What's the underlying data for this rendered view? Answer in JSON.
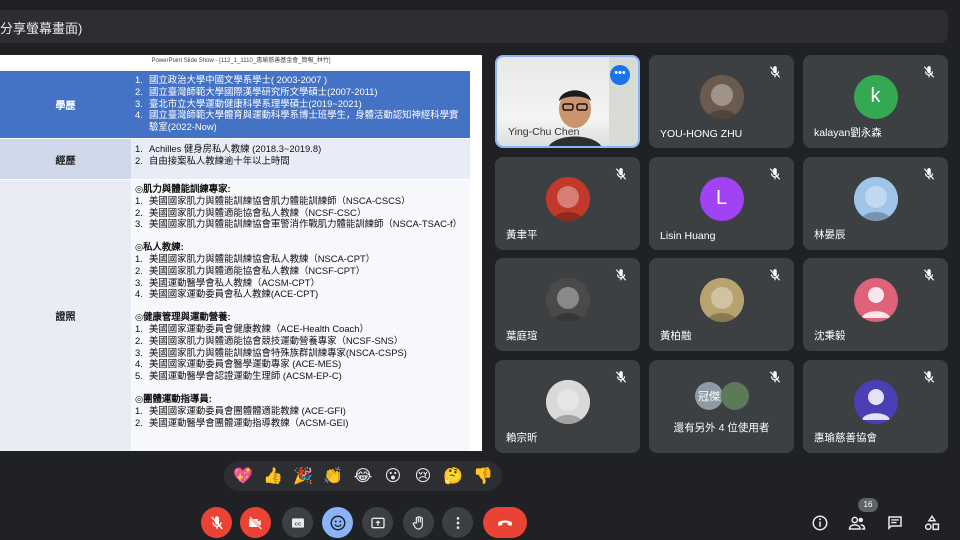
{
  "topbar": {
    "title": "分享螢幕畫面)"
  },
  "slide": {
    "header": "PowerPoint Slide Show - [112_1_1110_惠瑜慈善基金會_簡報_林竹]",
    "rows": [
      {
        "label": "學歷",
        "items": [
          {
            "n": "1.",
            "t": "國立政治大學中國文學系學士( 2003-2007 )"
          },
          {
            "n": "2.",
            "t": "國立臺灣師範大學國際漢學研究所文學碩士(2007-2011)"
          },
          {
            "n": "3.",
            "t": "臺北市立大學運動健康科學系理學碩士(2019~2021)"
          },
          {
            "n": "4.",
            "t": "國立臺灣師範大學體育與運動科學系博士班學生，身體活動認知神經科學實"
          },
          {
            "n": "",
            "t": "驗室(2022-Now)"
          }
        ]
      },
      {
        "label": "經歷",
        "items": [
          {
            "n": "1.",
            "t": "Achilles 健身房私人教練 (2018.3~2019.8)"
          },
          {
            "n": "2.",
            "t": "自由接案私人教練逾十年以上時間"
          }
        ]
      },
      {
        "label": "證照",
        "sections": [
          {
            "title": "◎肌力與體能訓練專家:",
            "items": [
              {
                "n": "1.",
                "t": "美國國家肌力與體能訓練協會肌力體能訓練師（NSCA-CSCS）"
              },
              {
                "n": "2.",
                "t": "美國國家肌力與體適能協會私人教練（NCSF-CSC）"
              },
              {
                "n": "3.",
                "t": "美國國家肌力與體能訓練協會軍警消作戰肌力體能訓練師（NSCA-TSAC-f）"
              }
            ]
          },
          {
            "title": "◎私人教練:",
            "items": [
              {
                "n": "1.",
                "t": "美國國家肌力與體能訓練協會私人教練（NSCA-CPT）"
              },
              {
                "n": "2.",
                "t": "美國國家肌力與體適能協會私人教練（NCSF-CPT）"
              },
              {
                "n": "3.",
                "t": "美國運動醫學會私人教練（ACSM-CPT）"
              },
              {
                "n": "4.",
                "t": "美國國家運動委員會私人教練(ACE-CPT)"
              }
            ]
          },
          {
            "title": "◎健康管理與運動營養:",
            "items": [
              {
                "n": "1.",
                "t": "美國國家運動委員會健康教練（ACE-Health Coach）"
              },
              {
                "n": "2.",
                "t": "美國國家肌力與體適能協會競技運動營養專家（NCSF-SNS）"
              },
              {
                "n": "3.",
                "t": "美國國家肌力與體能訓練協會特殊族群訓練專家(NSCA-CSPS)"
              },
              {
                "n": "4.",
                "t": "美國國家運動委員會醫學運動專家 (ACE-MES)"
              },
              {
                "n": "5.",
                "t": "美國運動醫學會認證運動生理師 (ACSM-EP-C)"
              }
            ]
          },
          {
            "title": "◎團體運動指導員:",
            "items": [
              {
                "n": "1.",
                "t": "美國國家運動委員會團體體適能教練 (ACE-GFI)"
              },
              {
                "n": "2.",
                "t": "美國運動醫學會團體運動指導教練（ACSM-GEI)"
              }
            ]
          }
        ]
      }
    ]
  },
  "participants": [
    {
      "name": "Ying-Chu Chen",
      "type": "video"
    },
    {
      "name": "YOU-HONG ZHU",
      "type": "photo",
      "color": "#6b5b4f"
    },
    {
      "name": "kalayan劉永森",
      "type": "letter",
      "letter": "k",
      "color": "#34a853"
    },
    {
      "name": "黃聿平",
      "type": "photo",
      "color": "#c0392b"
    },
    {
      "name": "Lisin Huang",
      "type": "letter",
      "letter": "L",
      "color": "#a142f4"
    },
    {
      "name": "林晏辰",
      "type": "photo",
      "color": "#9fc5e8"
    },
    {
      "name": "葉庭瑄",
      "type": "photo",
      "color": "#4a4a4a"
    },
    {
      "name": "黃柏融",
      "type": "photo",
      "color": "#b7a36f"
    },
    {
      "name": "沈秉毅",
      "type": "person",
      "color": "#e06279"
    },
    {
      "name": "賴宗昕",
      "type": "photo",
      "color": "#d9d9d9"
    },
    {
      "name": "還有另外 4 位使用者",
      "type": "group",
      "letter": "冠傑"
    },
    {
      "name": "惠瑜慈善協會",
      "type": "person",
      "color": "#4b3fb5"
    }
  ],
  "reactions": [
    "💖",
    "👍",
    "🎉",
    "👏",
    "😂",
    "😮",
    "😢",
    "🤔",
    "👎"
  ],
  "controls": {
    "people_count": "16"
  },
  "colors": {
    "accent": "#8ab4f8",
    "danger": "#ea4335",
    "tile": "#3c4043"
  }
}
